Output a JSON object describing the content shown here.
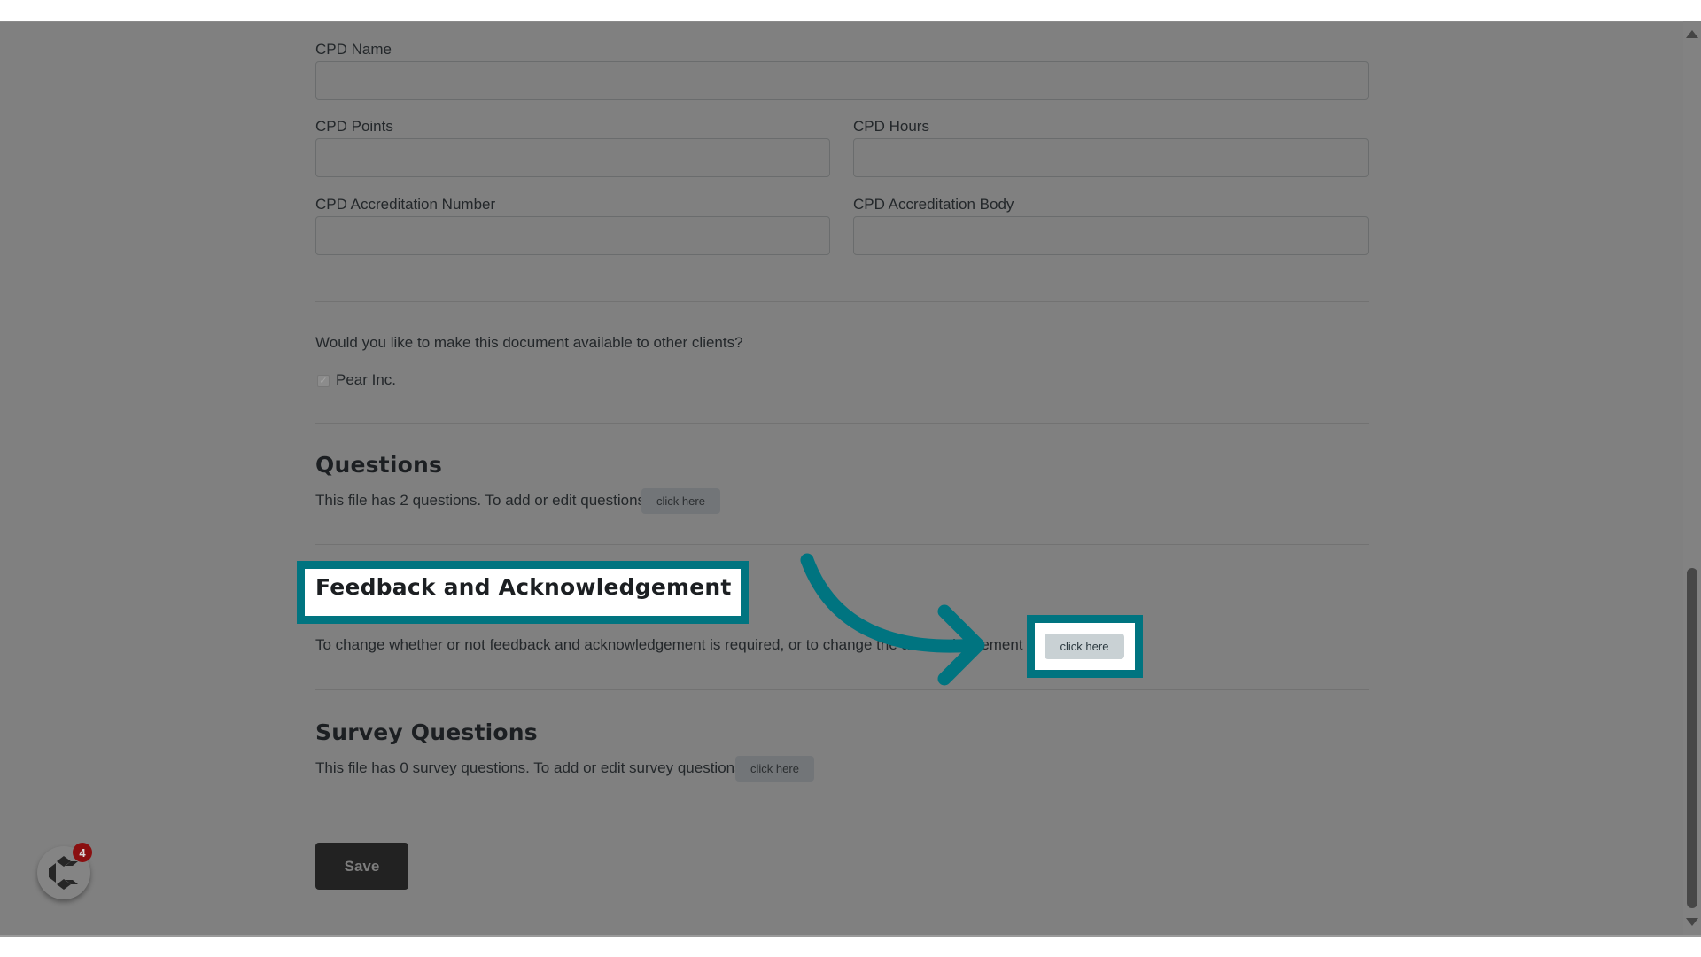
{
  "form": {
    "fields": [
      {
        "label": "CPD Name",
        "value": "",
        "placeholder": ""
      },
      {
        "label": "CPD Points",
        "value": "",
        "placeholder": ""
      },
      {
        "label": "CPD Hours",
        "value": "",
        "placeholder": ""
      },
      {
        "label": "CPD Accreditation Number",
        "value": "",
        "placeholder": ""
      },
      {
        "label": "CPD Accreditation Body",
        "value": "",
        "placeholder": ""
      }
    ],
    "sharing": {
      "question": "Would you like to make this document available to other clients?",
      "clients": [
        {
          "label": "Pear Inc.",
          "checked": true
        }
      ]
    }
  },
  "sections": {
    "questions": {
      "title": "Questions",
      "description": "This file has 2 questions. To add or edit questions",
      "button_label": "click here",
      "count": 2
    },
    "feedback": {
      "title": "Feedback and Acknowledgement",
      "description": "To change whether or not feedback and acknowledgement is required, or to change the acknowledgement text",
      "button_label": "click here"
    },
    "survey": {
      "title": "Survey Questions",
      "description": "This file has 0 survey questions. To add or edit survey questions",
      "button_label": "click here",
      "count": 0
    }
  },
  "actions": {
    "save_label": "Save"
  },
  "widget": {
    "icon": "c-logo-icon",
    "badge_count": "4"
  },
  "annotation": {
    "highlight_color": "#007480",
    "arrow_icon": "curved-arrow-icon"
  },
  "scrollbar": {
    "position_fraction": 0.6
  }
}
